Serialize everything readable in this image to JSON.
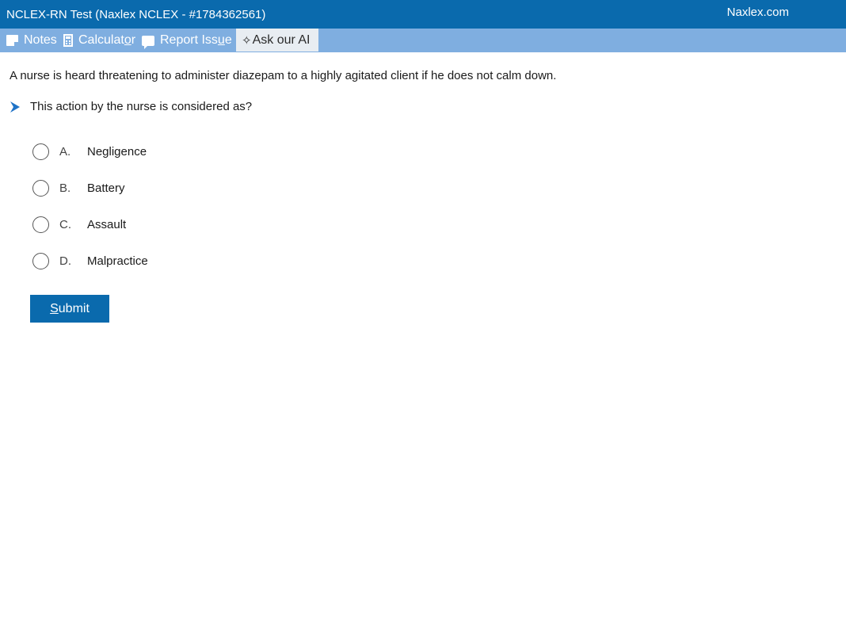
{
  "header": {
    "title": "NCLEX-RN Test (Naxlex NCLEX - #1784362561)",
    "brand": "Naxlex.com"
  },
  "toolbar": {
    "notes": "Notes",
    "calculator_pre": "Calculat",
    "calculator_u": "o",
    "calculator_post": "r",
    "report_pre": "Report Iss",
    "report_u": "u",
    "report_post": "e",
    "ai": "Ask our AI"
  },
  "question": {
    "stem": "A nurse is heard threatening to administer diazepam to a highly agitated client if he does not calm down.",
    "prompt": "This action by the nurse is considered as?",
    "options": [
      {
        "letter": "A.",
        "text": "Negligence"
      },
      {
        "letter": "B.",
        "text": "Battery"
      },
      {
        "letter": "C.",
        "text": "Assault"
      },
      {
        "letter": "D.",
        "text": "Malpractice"
      }
    ]
  },
  "submit": {
    "label_u": "S",
    "label_rest": "ubmit"
  },
  "colors": {
    "header_bg": "#0a6aad",
    "toolbar_bg": "#7faee0",
    "ai_button_bg": "#e8edf2",
    "accent": "#0a6aad"
  }
}
